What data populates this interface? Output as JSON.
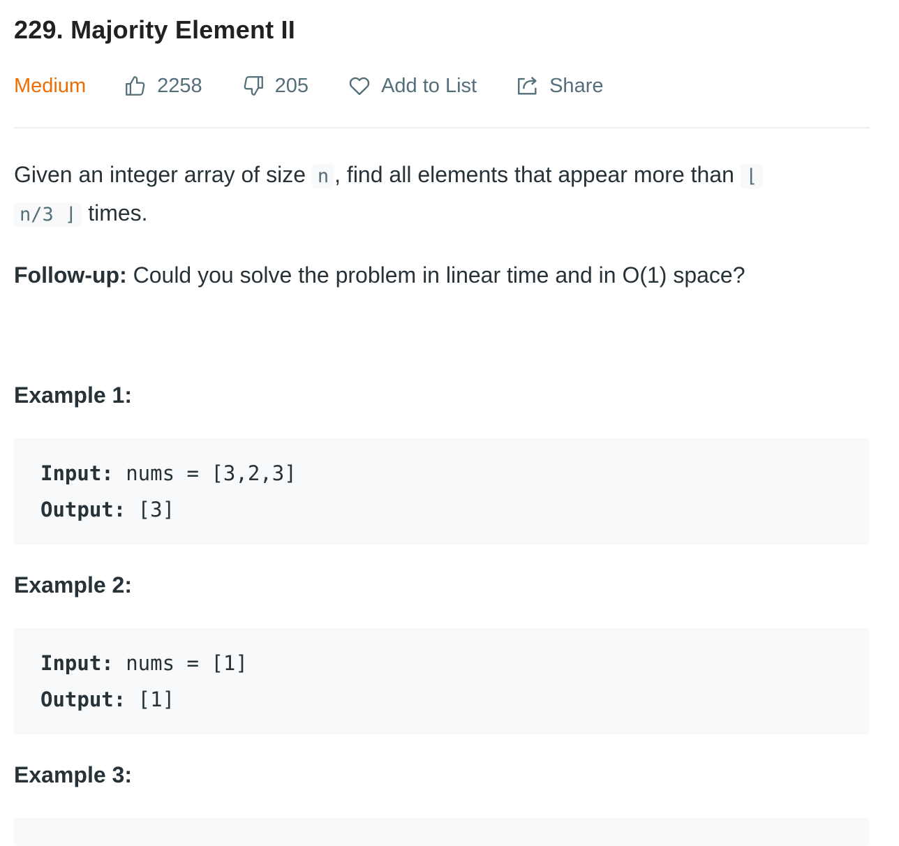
{
  "problem": {
    "number_title": "229. Majority Element II"
  },
  "meta": {
    "difficulty": "Medium",
    "likes": "2258",
    "dislikes": "205",
    "add_to_list": "Add to List",
    "share": "Share",
    "difficulty_color": "#ef6c00"
  },
  "description": {
    "part1": "Given an integer array of size ",
    "code_n": "n",
    "part2": ", find all elements that appear more than ",
    "floor_left": "⌊",
    "code_expr": "n/3",
    "floor_right": "⌋",
    "part3": " times."
  },
  "followup": {
    "label": "Follow-up:",
    "text": " Could you solve the problem in linear time and in O(1) space?"
  },
  "examples": [
    {
      "heading": "Example 1:",
      "input_label": "Input:",
      "input_value": " nums = [3,2,3]",
      "output_label": "Output:",
      "output_value": " [3]"
    },
    {
      "heading": "Example 2:",
      "input_label": "Input:",
      "input_value": " nums = [1]",
      "output_label": "Output:",
      "output_value": " [1]"
    },
    {
      "heading": "Example 3:"
    }
  ],
  "icons": {
    "likes": "thumbs-up-icon",
    "dislikes": "thumbs-down-icon",
    "add_to_list": "heart-icon",
    "share": "share-icon"
  }
}
